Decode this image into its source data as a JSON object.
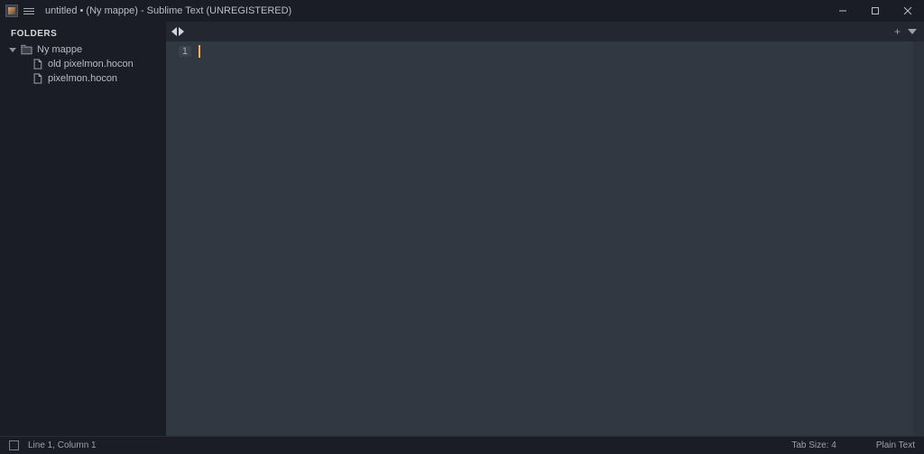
{
  "titlebar": {
    "title": "untitled • (Ny mappe) - Sublime Text (UNREGISTERED)"
  },
  "sidebar": {
    "heading": "FOLDERS",
    "root": {
      "label": "Ny mappe"
    },
    "files": [
      {
        "label": "old pixelmon.hocon"
      },
      {
        "label": "pixelmon.hocon"
      }
    ]
  },
  "editor": {
    "line_numbers": [
      "1"
    ]
  },
  "statusbar": {
    "position": "Line 1, Column 1",
    "tab_size": "Tab Size: 4",
    "syntax": "Plain Text"
  }
}
